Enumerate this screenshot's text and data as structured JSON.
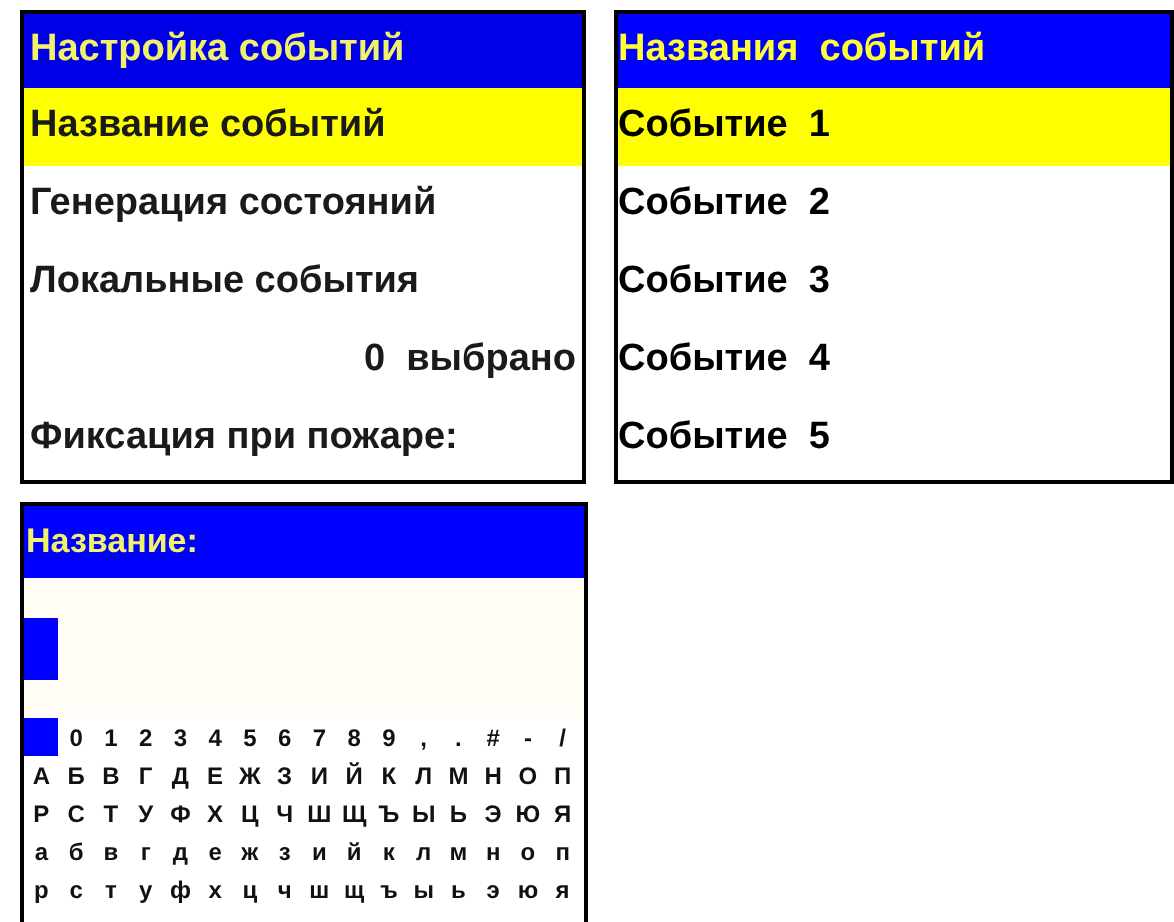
{
  "event_settings": {
    "title": "Настройка событий",
    "items": [
      {
        "kind": "item",
        "label": "Название событий",
        "selected": true
      },
      {
        "kind": "item",
        "label": "Генерация состояний",
        "selected": false
      },
      {
        "kind": "item",
        "label": "Локальные события",
        "selected": false
      },
      {
        "kind": "value",
        "label": "0  выбрано",
        "selected": false
      },
      {
        "kind": "item",
        "label": "Фиксация при пожаре:",
        "selected": false
      }
    ]
  },
  "event_names": {
    "title": "Названия  событий",
    "items": [
      {
        "label": "Событие  1",
        "selected": true
      },
      {
        "label": "Событие  2",
        "selected": false
      },
      {
        "label": "Событие  3",
        "selected": false
      },
      {
        "label": "Событие  4",
        "selected": false
      },
      {
        "label": "Событие  5",
        "selected": false
      }
    ]
  },
  "name_editor": {
    "title": "Название:",
    "cursor": true,
    "keyboard": [
      [
        {
          "kind": "space",
          "selected": true
        },
        {
          "kind": "char",
          "label": "0",
          "selected": false
        },
        {
          "kind": "char",
          "label": "1",
          "selected": false
        },
        {
          "kind": "char",
          "label": "2",
          "selected": false
        },
        {
          "kind": "char",
          "label": "3",
          "selected": false
        },
        {
          "kind": "char",
          "label": "4",
          "selected": false
        },
        {
          "kind": "char",
          "label": "5",
          "selected": false
        },
        {
          "kind": "char",
          "label": "6",
          "selected": false
        },
        {
          "kind": "char",
          "label": "7",
          "selected": false
        },
        {
          "kind": "char",
          "label": "8",
          "selected": false
        },
        {
          "kind": "char",
          "label": "9",
          "selected": false
        },
        {
          "kind": "char",
          "label": ",",
          "selected": false
        },
        {
          "kind": "char",
          "label": ".",
          "selected": false
        },
        {
          "kind": "char",
          "label": "#",
          "selected": false
        },
        {
          "kind": "char",
          "label": "-",
          "selected": false
        },
        {
          "kind": "char",
          "label": "/",
          "selected": false
        }
      ],
      [
        "А",
        "Б",
        "В",
        "Г",
        "Д",
        "Е",
        "Ж",
        "З",
        "И",
        "Й",
        "К",
        "Л",
        "М",
        "Н",
        "О",
        "П"
      ],
      [
        "Р",
        "С",
        "Т",
        "У",
        "Ф",
        "Х",
        "Ц",
        "Ч",
        "Ш",
        "Щ",
        "Ъ",
        "Ы",
        "Ь",
        "Э",
        "Ю",
        "Я"
      ],
      [
        "а",
        "б",
        "в",
        "г",
        "д",
        "е",
        "ж",
        "з",
        "и",
        "й",
        "к",
        "л",
        "м",
        "н",
        "о",
        "п"
      ],
      [
        "р",
        "с",
        "т",
        "у",
        "ф",
        "х",
        "ц",
        "ч",
        "ш",
        "щ",
        "ъ",
        "ы",
        "ь",
        "э",
        "ю",
        "я"
      ]
    ]
  }
}
